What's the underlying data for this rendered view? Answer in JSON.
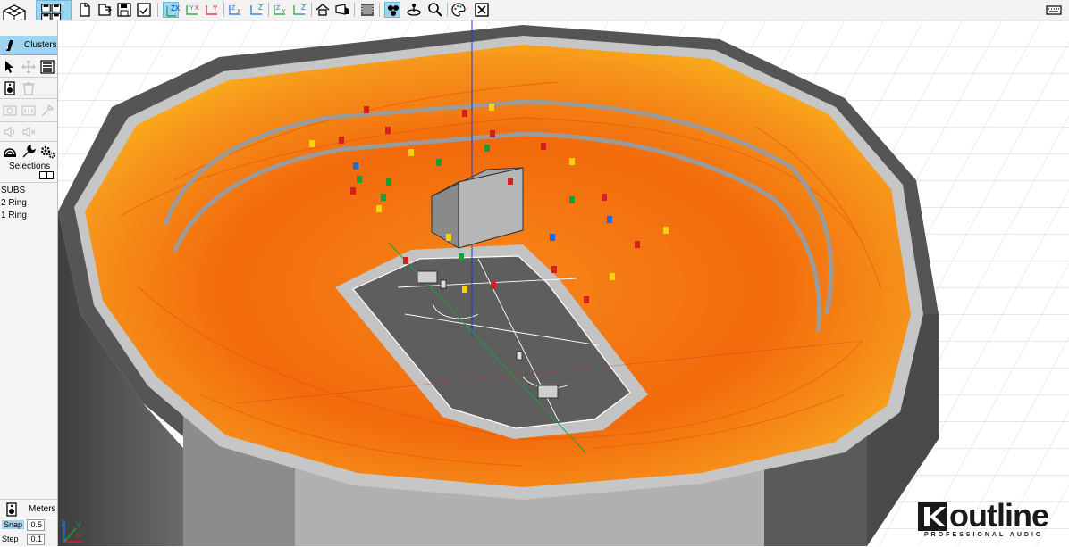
{
  "left_panel": {
    "clusters_label": "Clusters",
    "selections_label": "Selections",
    "cluster_items": [
      "SUBS",
      "2 Ring",
      "1 Ring"
    ],
    "meters_label": "Meters",
    "snap_label": "Snap",
    "snap_value": "0.5",
    "step_label": "Step",
    "step_value": "0.1"
  },
  "toolbar": {
    "view_planes": [
      "ZX",
      "YX",
      "ZY",
      "ZY"
    ]
  },
  "logo": {
    "word": "outline",
    "tagline": "PROFESSIONAL AUDIO"
  },
  "colors": {
    "accent_active": "#9fd4ee",
    "coverage_hot": "#f26a0c",
    "coverage_warm": "#fbb21a",
    "arena_wall": "#4b4b4b"
  }
}
